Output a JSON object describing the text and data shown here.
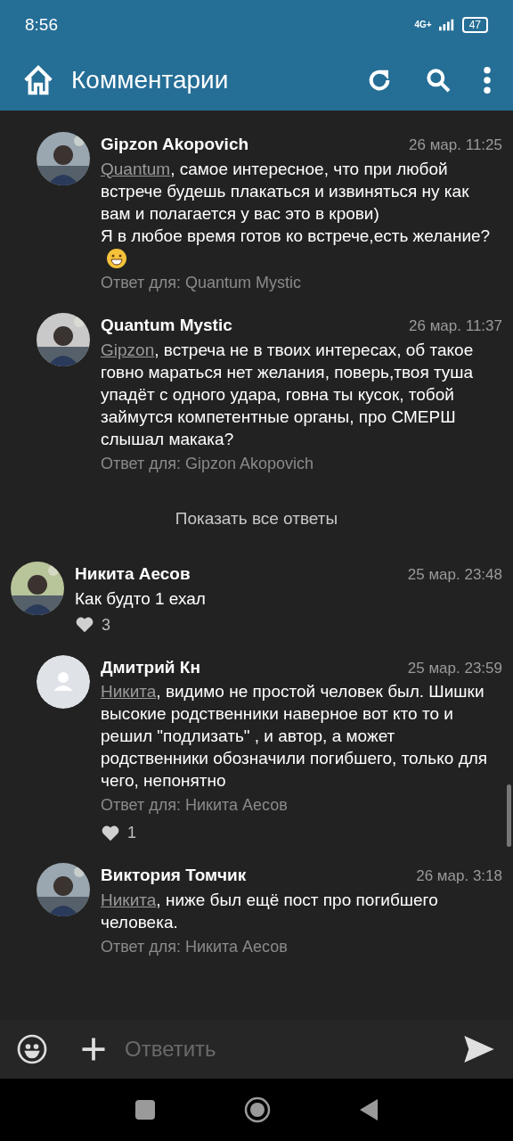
{
  "status_bar": {
    "time": "8:56",
    "network": "4G+",
    "battery": "47"
  },
  "app_bar": {
    "title": "Комментарии"
  },
  "comments": [
    {
      "kind": "reply",
      "author": "Gipzon Akopovich",
      "time": "26 мар. 11:25",
      "mention": "Quantum",
      "text": ", самое интересное, что при любой встрече будешь плакаться и извиняться ну как вам и полагается у вас это в крови)\nЯ в любое время готов ко встрече,есть желание?",
      "emoji": true,
      "reply_to": "Ответ для: Quantum Mystic"
    },
    {
      "kind": "reply",
      "author": "Quantum Mystic",
      "time": "26 мар. 11:37",
      "mention": "Gipzon",
      "text": ", встреча не в твоих интересах, об такое говно мараться нет желания, поверь,твоя туша упадёт с одного удара, говна ты кусок, тобой займутся компетентные органы, про СМЕРШ слышал макака?",
      "emoji": false,
      "reply_to": "Ответ для: Gipzon Akopovich"
    },
    {
      "kind": "show_all",
      "label": "Показать все ответы"
    },
    {
      "kind": "top",
      "author": "Никита Аесов",
      "time": "25 мар. 23:48",
      "text": "Как будто 1 ехал",
      "emoji": false,
      "likes": "3"
    },
    {
      "kind": "reply",
      "avatar": {
        "kind": "default"
      },
      "author": "Дмитрий Кн",
      "time": "25 мар. 23:59",
      "mention": "Никита",
      "text": ", видимо не простой человек был. Шишки высокие родственники наверное вот кто то и решил \"подлизать\" , и автор, а может родственники обозначили погибшего, только для чего, непонятно",
      "emoji": false,
      "reply_to": "Ответ для: Никита Аесов",
      "likes": "1"
    },
    {
      "kind": "reply",
      "author": "Виктория Томчик",
      "time": "26 мар. 3:18",
      "mention": "Никита",
      "text": ", ниже был ещё пост про погибшего человека.",
      "emoji": false,
      "reply_to": "Ответ для: Никита Аесов"
    }
  ],
  "composer": {
    "placeholder": "Ответить"
  }
}
